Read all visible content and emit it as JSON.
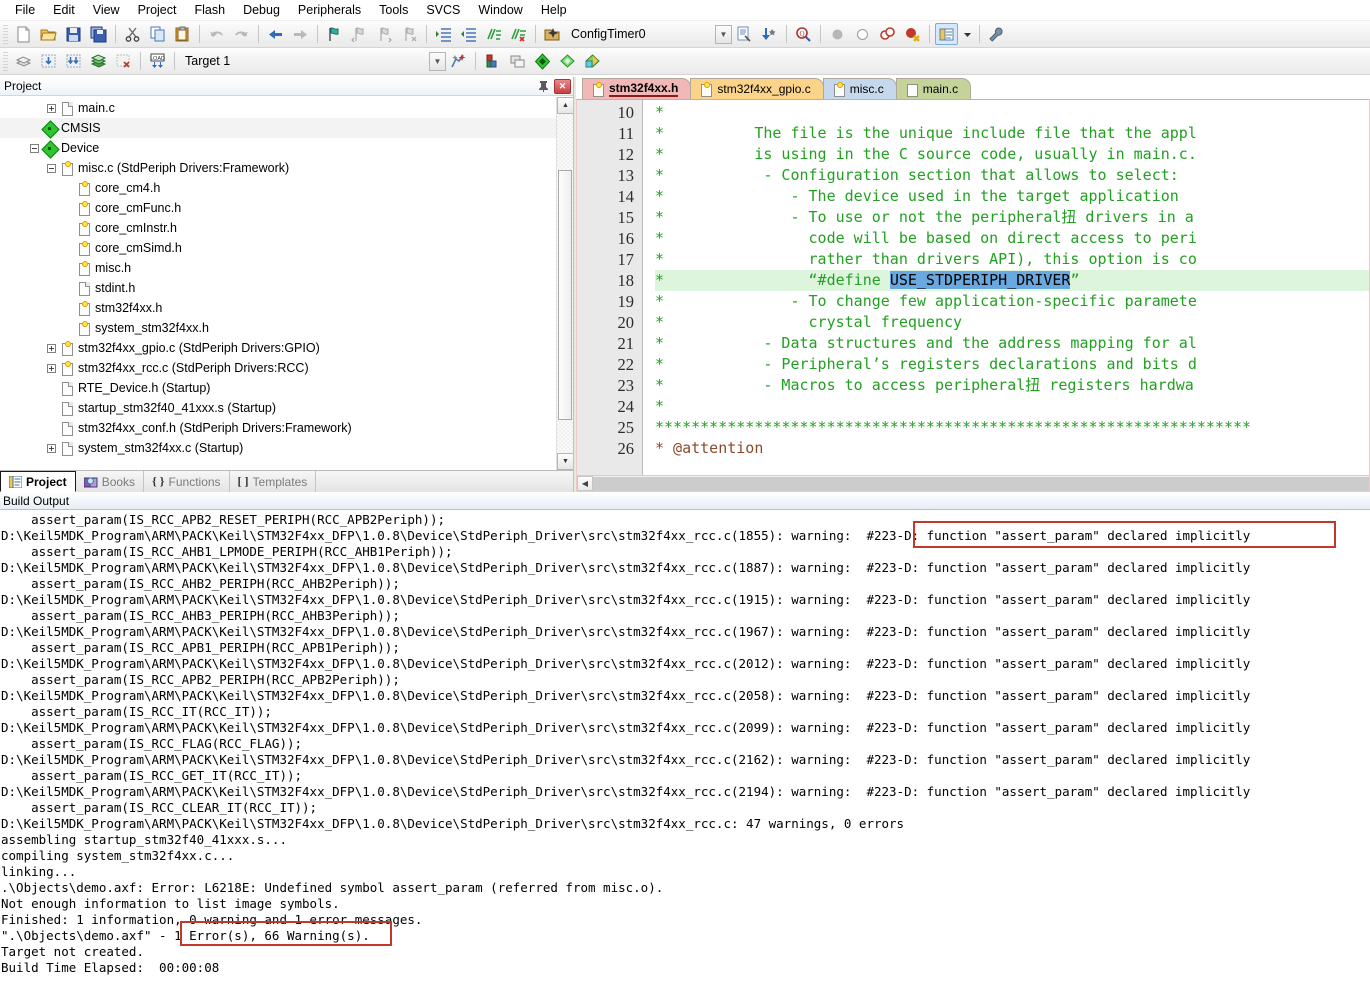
{
  "menu": {
    "items": [
      "File",
      "Edit",
      "View",
      "Project",
      "Flash",
      "Debug",
      "Peripherals",
      "Tools",
      "SVCS",
      "Window",
      "Help"
    ]
  },
  "toolbar_main": {
    "buttons": [
      {
        "name": "new-file-icon",
        "tip": "New"
      },
      {
        "name": "open-file-icon",
        "tip": "Open"
      },
      {
        "name": "save-icon",
        "tip": "Save"
      },
      {
        "name": "save-all-icon",
        "tip": "Save All"
      },
      {
        "name": "cut-icon",
        "tip": "Cut"
      },
      {
        "name": "copy-icon",
        "tip": "Copy"
      },
      {
        "name": "paste-icon",
        "tip": "Paste"
      },
      {
        "name": "undo-icon",
        "tip": "Undo"
      },
      {
        "name": "redo-icon",
        "tip": "Redo"
      },
      {
        "name": "navigate-back-icon",
        "tip": "Back"
      },
      {
        "name": "navigate-forward-icon",
        "tip": "Forward"
      },
      {
        "name": "bookmark-toggle-icon",
        "tip": "Toggle Bookmark"
      },
      {
        "name": "bookmark-prev-icon",
        "tip": "Previous Bookmark"
      },
      {
        "name": "bookmark-next-icon",
        "tip": "Next Bookmark"
      },
      {
        "name": "bookmark-clear-icon",
        "tip": "Clear Bookmarks"
      },
      {
        "name": "indent-increase-icon",
        "tip": "Indent"
      },
      {
        "name": "indent-decrease-icon",
        "tip": "Outdent"
      },
      {
        "name": "comment-icon",
        "tip": "Comment"
      },
      {
        "name": "uncomment-icon",
        "tip": "Uncomment"
      }
    ],
    "config_name": "ConfigTimer0",
    "right_buttons": [
      {
        "name": "file-properties-icon"
      },
      {
        "name": "insert-icon"
      },
      {
        "name": "find-in-files-icon"
      },
      {
        "name": "breakpoint-icon"
      },
      {
        "name": "breakpoint-disable-icon"
      },
      {
        "name": "breakpoint-kill-all-icon"
      },
      {
        "name": "breakpoint-disable-all-icon"
      },
      {
        "name": "project-window-icon"
      },
      {
        "name": "chevron-down-icon"
      },
      {
        "name": "configure-icon"
      }
    ]
  },
  "toolbar_build": {
    "buttons": [
      {
        "name": "translate-icon"
      },
      {
        "name": "build-icon"
      },
      {
        "name": "rebuild-icon"
      },
      {
        "name": "batch-build-icon"
      },
      {
        "name": "stop-build-icon"
      },
      {
        "name": "download-icon"
      }
    ],
    "target_label": "Target 1",
    "right_buttons": [
      {
        "name": "target-options-icon"
      },
      {
        "name": "manage-project-items-icon"
      },
      {
        "name": "manage-run-time-env-icon"
      },
      {
        "name": "select-software-packs-icon"
      },
      {
        "name": "pack-installer-icon"
      }
    ]
  },
  "project_panel": {
    "title": "Project",
    "pin_icon": "pin-icon",
    "close_icon": "close-icon",
    "tabs": [
      {
        "label": "Project",
        "icon": "project-icon",
        "active": true
      },
      {
        "label": "Books",
        "icon": "books-icon",
        "active": false
      },
      {
        "label": "Functions",
        "icon": "functions-icon",
        "active": false
      },
      {
        "label": "Templates",
        "icon": "templates-icon",
        "active": false
      }
    ],
    "tree": [
      {
        "label": "main.c",
        "indent": 3,
        "icon": "doc",
        "expander": "plus",
        "shade": false
      },
      {
        "label": "CMSIS",
        "indent": 2,
        "icon": "dia",
        "expander": "none",
        "shade": true
      },
      {
        "label": "Device",
        "indent": 2,
        "icon": "dia",
        "expander": "minus",
        "shade": false
      },
      {
        "label": "misc.c (StdPeriph Drivers:Framework)",
        "indent": 3,
        "icon": "key",
        "expander": "minus",
        "shade": false
      },
      {
        "label": "core_cm4.h",
        "indent": 4,
        "icon": "key",
        "expander": "none",
        "shade": false
      },
      {
        "label": "core_cmFunc.h",
        "indent": 4,
        "icon": "key",
        "expander": "none",
        "shade": false
      },
      {
        "label": "core_cmInstr.h",
        "indent": 4,
        "icon": "key",
        "expander": "none",
        "shade": false
      },
      {
        "label": "core_cmSimd.h",
        "indent": 4,
        "icon": "key",
        "expander": "none",
        "shade": false
      },
      {
        "label": "misc.h",
        "indent": 4,
        "icon": "key",
        "expander": "none",
        "shade": false
      },
      {
        "label": "stdint.h",
        "indent": 4,
        "icon": "doc",
        "expander": "none",
        "shade": false
      },
      {
        "label": "stm32f4xx.h",
        "indent": 4,
        "icon": "key",
        "expander": "none",
        "shade": false
      },
      {
        "label": "system_stm32f4xx.h",
        "indent": 4,
        "icon": "key",
        "expander": "none",
        "shade": false
      },
      {
        "label": "stm32f4xx_gpio.c (StdPeriph Drivers:GPIO)",
        "indent": 3,
        "icon": "key",
        "expander": "plus",
        "shade": false
      },
      {
        "label": "stm32f4xx_rcc.c (StdPeriph Drivers:RCC)",
        "indent": 3,
        "icon": "key",
        "expander": "plus",
        "shade": false
      },
      {
        "label": "RTE_Device.h (Startup)",
        "indent": 3,
        "icon": "doc",
        "expander": "none",
        "shade": false
      },
      {
        "label": "startup_stm32f40_41xxx.s (Startup)",
        "indent": 3,
        "icon": "doc",
        "expander": "none",
        "shade": false
      },
      {
        "label": "stm32f4xx_conf.h (StdPeriph Drivers:Framework)",
        "indent": 3,
        "icon": "doc",
        "expander": "none",
        "shade": false
      },
      {
        "label": "system_stm32f4xx.c (Startup)",
        "indent": 3,
        "icon": "doc",
        "expander": "plus",
        "shade": false
      }
    ]
  },
  "editor": {
    "tabs": [
      {
        "label": "stm32f4xx.h",
        "icon": "key",
        "active": true,
        "color": "#f2b8b8"
      },
      {
        "label": "stm32f4xx_gpio.c",
        "icon": "key",
        "active": false,
        "color": "#fbd48a"
      },
      {
        "label": "misc.c",
        "icon": "key",
        "active": false,
        "color": "#c6d9ec"
      },
      {
        "label": "main.c",
        "icon": "doc",
        "active": false,
        "color": "#c4d39a"
      }
    ],
    "first_line_number": 10,
    "lines": [
      {
        "n": 10,
        "text": "*",
        "highlight": false
      },
      {
        "n": 11,
        "text": "*          The file is the unique include file that the appl",
        "highlight": false
      },
      {
        "n": 12,
        "text": "*          is using in the C source code, usually in main.c.",
        "highlight": false
      },
      {
        "n": 13,
        "text": "*           - Configuration section that allows to select:",
        "highlight": false
      },
      {
        "n": 14,
        "text": "*              - The device used in the target application",
        "highlight": false
      },
      {
        "n": 15,
        "text": "*              - To use or not the peripheral扭 drivers in a",
        "highlight": false
      },
      {
        "n": 16,
        "text": "*                code will be based on direct access to peri",
        "highlight": false
      },
      {
        "n": 17,
        "text": "*                rather than drivers API), this option is co",
        "highlight": false
      },
      {
        "n": 18,
        "text": "*                “#define USE_STDPERIPH_DRIVER”",
        "highlight": true,
        "selection": "USE_STDPERIPH_DRIVER"
      },
      {
        "n": 19,
        "text": "*              - To change few application-specific paramete",
        "highlight": false
      },
      {
        "n": 20,
        "text": "*                crystal frequency",
        "highlight": false
      },
      {
        "n": 21,
        "text": "*           - Data structures and the address mapping for al",
        "highlight": false
      },
      {
        "n": 22,
        "text": "*           - Peripheral’s registers declarations and bits d",
        "highlight": false
      },
      {
        "n": 23,
        "text": "*           - Macros to access peripheral扭 registers hardwa",
        "highlight": false
      },
      {
        "n": 24,
        "text": "*",
        "highlight": false
      },
      {
        "n": 25,
        "text": "******************************************************************",
        "highlight": false
      },
      {
        "n": 26,
        "text": "* @attention",
        "highlight": false,
        "style": "attention"
      }
    ]
  },
  "build_output": {
    "title": "Build Output",
    "lines": [
      "    assert_param(IS_RCC_APB2_RESET_PERIPH(RCC_APB2Periph));",
      "D:\\Keil5MDK_Program\\ARM\\PACK\\Keil\\STM32F4xx_DFP\\1.0.8\\Device\\StdPeriph_Driver\\src\\stm32f4xx_rcc.c(1855): warning:  #223-D: function \"assert_param\" declared implicitly",
      "    assert_param(IS_RCC_AHB1_LPMODE_PERIPH(RCC_AHB1Periph));",
      "D:\\Keil5MDK_Program\\ARM\\PACK\\Keil\\STM32F4xx_DFP\\1.0.8\\Device\\StdPeriph_Driver\\src\\stm32f4xx_rcc.c(1887): warning:  #223-D: function \"assert_param\" declared implicitly",
      "    assert_param(IS_RCC_AHB2_PERIPH(RCC_AHB2Periph));",
      "D:\\Keil5MDK_Program\\ARM\\PACK\\Keil\\STM32F4xx_DFP\\1.0.8\\Device\\StdPeriph_Driver\\src\\stm32f4xx_rcc.c(1915): warning:  #223-D: function \"assert_param\" declared implicitly",
      "    assert_param(IS_RCC_AHB3_PERIPH(RCC_AHB3Periph));",
      "D:\\Keil5MDK_Program\\ARM\\PACK\\Keil\\STM32F4xx_DFP\\1.0.8\\Device\\StdPeriph_Driver\\src\\stm32f4xx_rcc.c(1967): warning:  #223-D: function \"assert_param\" declared implicitly",
      "    assert_param(IS_RCC_APB1_PERIPH(RCC_APB1Periph));",
      "D:\\Keil5MDK_Program\\ARM\\PACK\\Keil\\STM32F4xx_DFP\\1.0.8\\Device\\StdPeriph_Driver\\src\\stm32f4xx_rcc.c(2012): warning:  #223-D: function \"assert_param\" declared implicitly",
      "    assert_param(IS_RCC_APB2_PERIPH(RCC_APB2Periph));",
      "D:\\Keil5MDK_Program\\ARM\\PACK\\Keil\\STM32F4xx_DFP\\1.0.8\\Device\\StdPeriph_Driver\\src\\stm32f4xx_rcc.c(2058): warning:  #223-D: function \"assert_param\" declared implicitly",
      "    assert_param(IS_RCC_IT(RCC_IT));",
      "D:\\Keil5MDK_Program\\ARM\\PACK\\Keil\\STM32F4xx_DFP\\1.0.8\\Device\\StdPeriph_Driver\\src\\stm32f4xx_rcc.c(2099): warning:  #223-D: function \"assert_param\" declared implicitly",
      "    assert_param(IS_RCC_FLAG(RCC_FLAG));",
      "D:\\Keil5MDK_Program\\ARM\\PACK\\Keil\\STM32F4xx_DFP\\1.0.8\\Device\\StdPeriph_Driver\\src\\stm32f4xx_rcc.c(2162): warning:  #223-D: function \"assert_param\" declared implicitly",
      "    assert_param(IS_RCC_GET_IT(RCC_IT));",
      "D:\\Keil5MDK_Program\\ARM\\PACK\\Keil\\STM32F4xx_DFP\\1.0.8\\Device\\StdPeriph_Driver\\src\\stm32f4xx_rcc.c(2194): warning:  #223-D: function \"assert_param\" declared implicitly",
      "    assert_param(IS_RCC_CLEAR_IT(RCC_IT));",
      "D:\\Keil5MDK_Program\\ARM\\PACK\\Keil\\STM32F4xx_DFP\\1.0.8\\Device\\StdPeriph_Driver\\src\\stm32f4xx_rcc.c: 47 warnings, 0 errors",
      "assembling startup_stm32f40_41xxx.s...",
      "compiling system_stm32f4xx.c...",
      "linking...",
      ".\\Objects\\demo.axf: Error: L6218E: Undefined symbol assert_param (referred from misc.o).",
      "Not enough information to list image symbols.",
      "Finished: 1 information, 0 warning and 1 error messages.",
      "\".\\Objects\\demo.axf\" - 1 Error(s), 66 Warning(s).",
      "Target not created.",
      "Build Time Elapsed:  00:00:08"
    ]
  },
  "annotations": {
    "box_warning_label": "#223-D: function \"assert_param\" declared implicitly",
    "box_summary_label": "1 Error(s), 66 Warning(s).",
    "box_color": "#c0392b"
  }
}
